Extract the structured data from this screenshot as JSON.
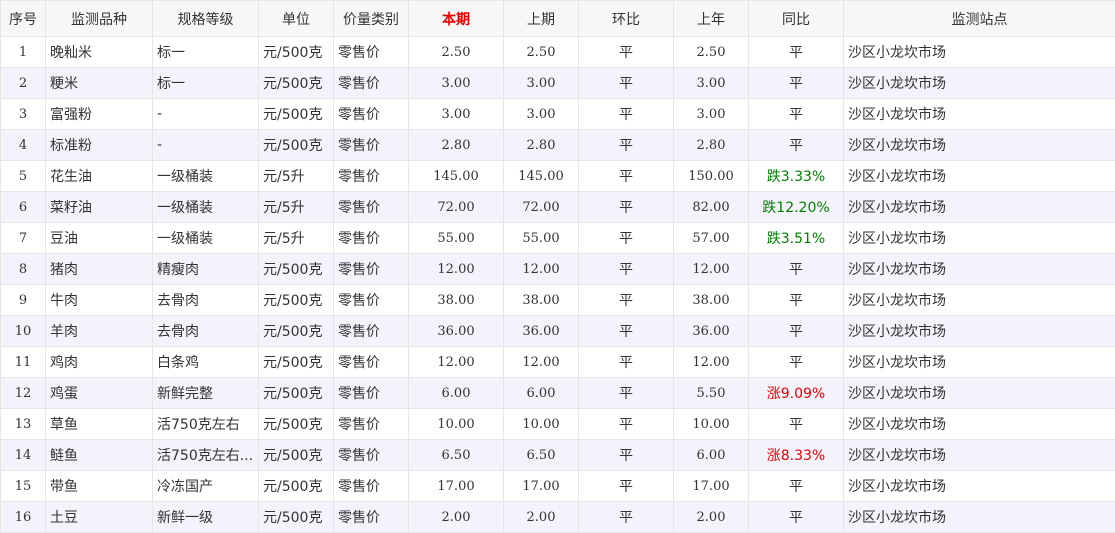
{
  "headers": {
    "seq": "序号",
    "item": "监测品种",
    "spec": "规格等级",
    "unit": "单位",
    "price_type": "价量类别",
    "current": "本期",
    "previous": "上期",
    "mom": "环比",
    "last_year": "上年",
    "yoy": "同比",
    "station": "监测站点"
  },
  "colors": {
    "highlight": "#e60000",
    "down": "#008000",
    "up": "#e60000",
    "row_stripe": "#f4f2fb",
    "border": "#e6e6e6"
  },
  "rows": [
    {
      "seq": "1",
      "item": "晚籼米",
      "spec": "标一",
      "unit": "元/500克",
      "price_type": "零售价",
      "current": "2.50",
      "previous": "2.50",
      "mom": "平",
      "last_year": "2.50",
      "yoy": "平",
      "trend": "flat",
      "station": "沙区小龙坎市场"
    },
    {
      "seq": "2",
      "item": "粳米",
      "spec": "标一",
      "unit": "元/500克",
      "price_type": "零售价",
      "current": "3.00",
      "previous": "3.00",
      "mom": "平",
      "last_year": "3.00",
      "yoy": "平",
      "trend": "flat",
      "station": "沙区小龙坎市场"
    },
    {
      "seq": "3",
      "item": "富强粉",
      "spec": "-",
      "unit": "元/500克",
      "price_type": "零售价",
      "current": "3.00",
      "previous": "3.00",
      "mom": "平",
      "last_year": "3.00",
      "yoy": "平",
      "trend": "flat",
      "station": "沙区小龙坎市场"
    },
    {
      "seq": "4",
      "item": "标准粉",
      "spec": "-",
      "unit": "元/500克",
      "price_type": "零售价",
      "current": "2.80",
      "previous": "2.80",
      "mom": "平",
      "last_year": "2.80",
      "yoy": "平",
      "trend": "flat",
      "station": "沙区小龙坎市场"
    },
    {
      "seq": "5",
      "item": "花生油",
      "spec": "一级桶装",
      "unit": "元/5升",
      "price_type": "零售价",
      "current": "145.00",
      "previous": "145.00",
      "mom": "平",
      "last_year": "150.00",
      "yoy": "跌3.33%",
      "trend": "down",
      "station": "沙区小龙坎市场"
    },
    {
      "seq": "6",
      "item": "菜籽油",
      "spec": "一级桶装",
      "unit": "元/5升",
      "price_type": "零售价",
      "current": "72.00",
      "previous": "72.00",
      "mom": "平",
      "last_year": "82.00",
      "yoy": "跌12.20%",
      "trend": "down",
      "station": "沙区小龙坎市场"
    },
    {
      "seq": "7",
      "item": "豆油",
      "spec": "一级桶装",
      "unit": "元/5升",
      "price_type": "零售价",
      "current": "55.00",
      "previous": "55.00",
      "mom": "平",
      "last_year": "57.00",
      "yoy": "跌3.51%",
      "trend": "down",
      "station": "沙区小龙坎市场"
    },
    {
      "seq": "8",
      "item": "猪肉",
      "spec": "精瘦肉",
      "unit": "元/500克",
      "price_type": "零售价",
      "current": "12.00",
      "previous": "12.00",
      "mom": "平",
      "last_year": "12.00",
      "yoy": "平",
      "trend": "flat",
      "station": "沙区小龙坎市场"
    },
    {
      "seq": "9",
      "item": "牛肉",
      "spec": "去骨肉",
      "unit": "元/500克",
      "price_type": "零售价",
      "current": "38.00",
      "previous": "38.00",
      "mom": "平",
      "last_year": "38.00",
      "yoy": "平",
      "trend": "flat",
      "station": "沙区小龙坎市场"
    },
    {
      "seq": "10",
      "item": "羊肉",
      "spec": "去骨肉",
      "unit": "元/500克",
      "price_type": "零售价",
      "current": "36.00",
      "previous": "36.00",
      "mom": "平",
      "last_year": "36.00",
      "yoy": "平",
      "trend": "flat",
      "station": "沙区小龙坎市场"
    },
    {
      "seq": "11",
      "item": "鸡肉",
      "spec": "白条鸡",
      "unit": "元/500克",
      "price_type": "零售价",
      "current": "12.00",
      "previous": "12.00",
      "mom": "平",
      "last_year": "12.00",
      "yoy": "平",
      "trend": "flat",
      "station": "沙区小龙坎市场"
    },
    {
      "seq": "12",
      "item": "鸡蛋",
      "spec": "新鲜完整",
      "unit": "元/500克",
      "price_type": "零售价",
      "current": "6.00",
      "previous": "6.00",
      "mom": "平",
      "last_year": "5.50",
      "yoy": "涨9.09%",
      "trend": "up",
      "station": "沙区小龙坎市场"
    },
    {
      "seq": "13",
      "item": "草鱼",
      "spec": "活750克左右",
      "unit": "元/500克",
      "price_type": "零售价",
      "current": "10.00",
      "previous": "10.00",
      "mom": "平",
      "last_year": "10.00",
      "yoy": "平",
      "trend": "flat",
      "station": "沙区小龙坎市场"
    },
    {
      "seq": "14",
      "item": "鲢鱼",
      "spec": "活750克左右...",
      "unit": "元/500克",
      "price_type": "零售价",
      "current": "6.50",
      "previous": "6.50",
      "mom": "平",
      "last_year": "6.00",
      "yoy": "涨8.33%",
      "trend": "up",
      "station": "沙区小龙坎市场"
    },
    {
      "seq": "15",
      "item": "带鱼",
      "spec": "冷冻国产",
      "unit": "元/500克",
      "price_type": "零售价",
      "current": "17.00",
      "previous": "17.00",
      "mom": "平",
      "last_year": "17.00",
      "yoy": "平",
      "trend": "flat",
      "station": "沙区小龙坎市场"
    },
    {
      "seq": "16",
      "item": "土豆",
      "spec": "新鲜一级",
      "unit": "元/500克",
      "price_type": "零售价",
      "current": "2.00",
      "previous": "2.00",
      "mom": "平",
      "last_year": "2.00",
      "yoy": "平",
      "trend": "flat",
      "station": "沙区小龙坎市场"
    }
  ]
}
